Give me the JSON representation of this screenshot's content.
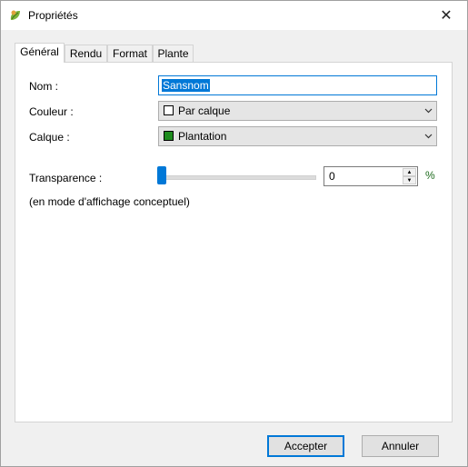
{
  "window": {
    "title": "Propriétés",
    "close_glyph": "✕"
  },
  "tabs": [
    {
      "label": "Général",
      "active": true
    },
    {
      "label": "Rendu",
      "active": false
    },
    {
      "label": "Format",
      "active": false
    },
    {
      "label": "Plante",
      "active": false
    }
  ],
  "general": {
    "nom_label": "Nom :",
    "nom_value": "Sansnom",
    "couleur_label": "Couleur :",
    "couleur_value": "Par calque",
    "couleur_swatch": "#ffffff",
    "calque_label": "Calque :",
    "calque_value": "Plantation",
    "calque_swatch": "#1e8c1e",
    "transparence_label": "Transparence :",
    "transparence_value": "0",
    "transparence_level": 0,
    "percent_sign": "%",
    "note": "(en mode d'affichage conceptuel)"
  },
  "buttons": {
    "accept": "Accepter",
    "cancel": "Annuler"
  },
  "colors": {
    "accent": "#0078d7"
  }
}
